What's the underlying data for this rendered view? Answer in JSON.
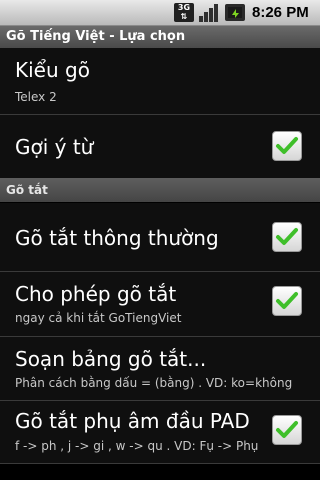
{
  "status_bar": {
    "network_label": "3G",
    "time": "8:26 PM"
  },
  "title_bar": {
    "title": "Gõ Tiếng Việt - Lựa chọn"
  },
  "preferences": {
    "typing_mode": {
      "title": "Kiểu gõ",
      "summary": "Telex 2"
    },
    "suggest_words": {
      "title": "Gợi ý từ",
      "checked": true
    },
    "category_shortcuts": "Gõ tắt",
    "normal_shortcuts": {
      "title": "Gõ tắt thông thường",
      "checked": true
    },
    "allow_shortcuts": {
      "title": "Cho phép gõ tắt",
      "summary": "ngay cả khi tắt GoTiengViet",
      "checked": true
    },
    "edit_shortcut_table": {
      "title": "Soạn bảng gõ tắt...",
      "summary": "Phân cách bằng dấu = (bằng) . VD: ko=không"
    },
    "initial_consonant_shortcuts": {
      "title": "Gõ tắt phụ âm đầu PAD",
      "summary": "f -> ph , j -> gi , w -> qu . VD: Fụ -> Phụ",
      "checked": true
    }
  },
  "colors": {
    "check": "#3fbf2a",
    "background": "#000000"
  }
}
